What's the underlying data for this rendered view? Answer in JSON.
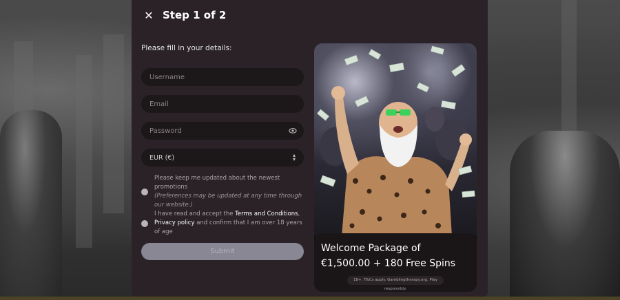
{
  "modal": {
    "close_glyph": "✕",
    "step_title": "Step 1 of 2",
    "intro": "Please fill in your details:"
  },
  "form": {
    "username_placeholder": "Username",
    "email_placeholder": "Email",
    "password_placeholder": "Password",
    "currency_value": "EUR (€)",
    "promo_optin_text": "Please keep me updated about the newest promotions",
    "promo_optin_note": "(Preferences may be updated at any time through our website.)",
    "terms_prefix": "I have read and accept the ",
    "terms_link": "Terms and Conditions",
    "terms_comma": ",",
    "privacy_link": "Privacy policy",
    "terms_suffix": " and confirm that I am over 18 years of age",
    "submit_label": "Submit"
  },
  "promo": {
    "title_line1": "Welcome Package of",
    "title_line2": "€1,500.00 + 180 Free Spins",
    "disclaimer": "18+. T&Cs apply. Gamblingtherapy.org. Play responsibly."
  },
  "icons": {
    "close": "close-icon",
    "password_toggle": "eye-icon",
    "currency_select": "chevron-updown-icon"
  },
  "colors": {
    "modal_bg": "#2a2226",
    "field_bg": "#1c1719",
    "submit_bg": "#8a8794"
  }
}
